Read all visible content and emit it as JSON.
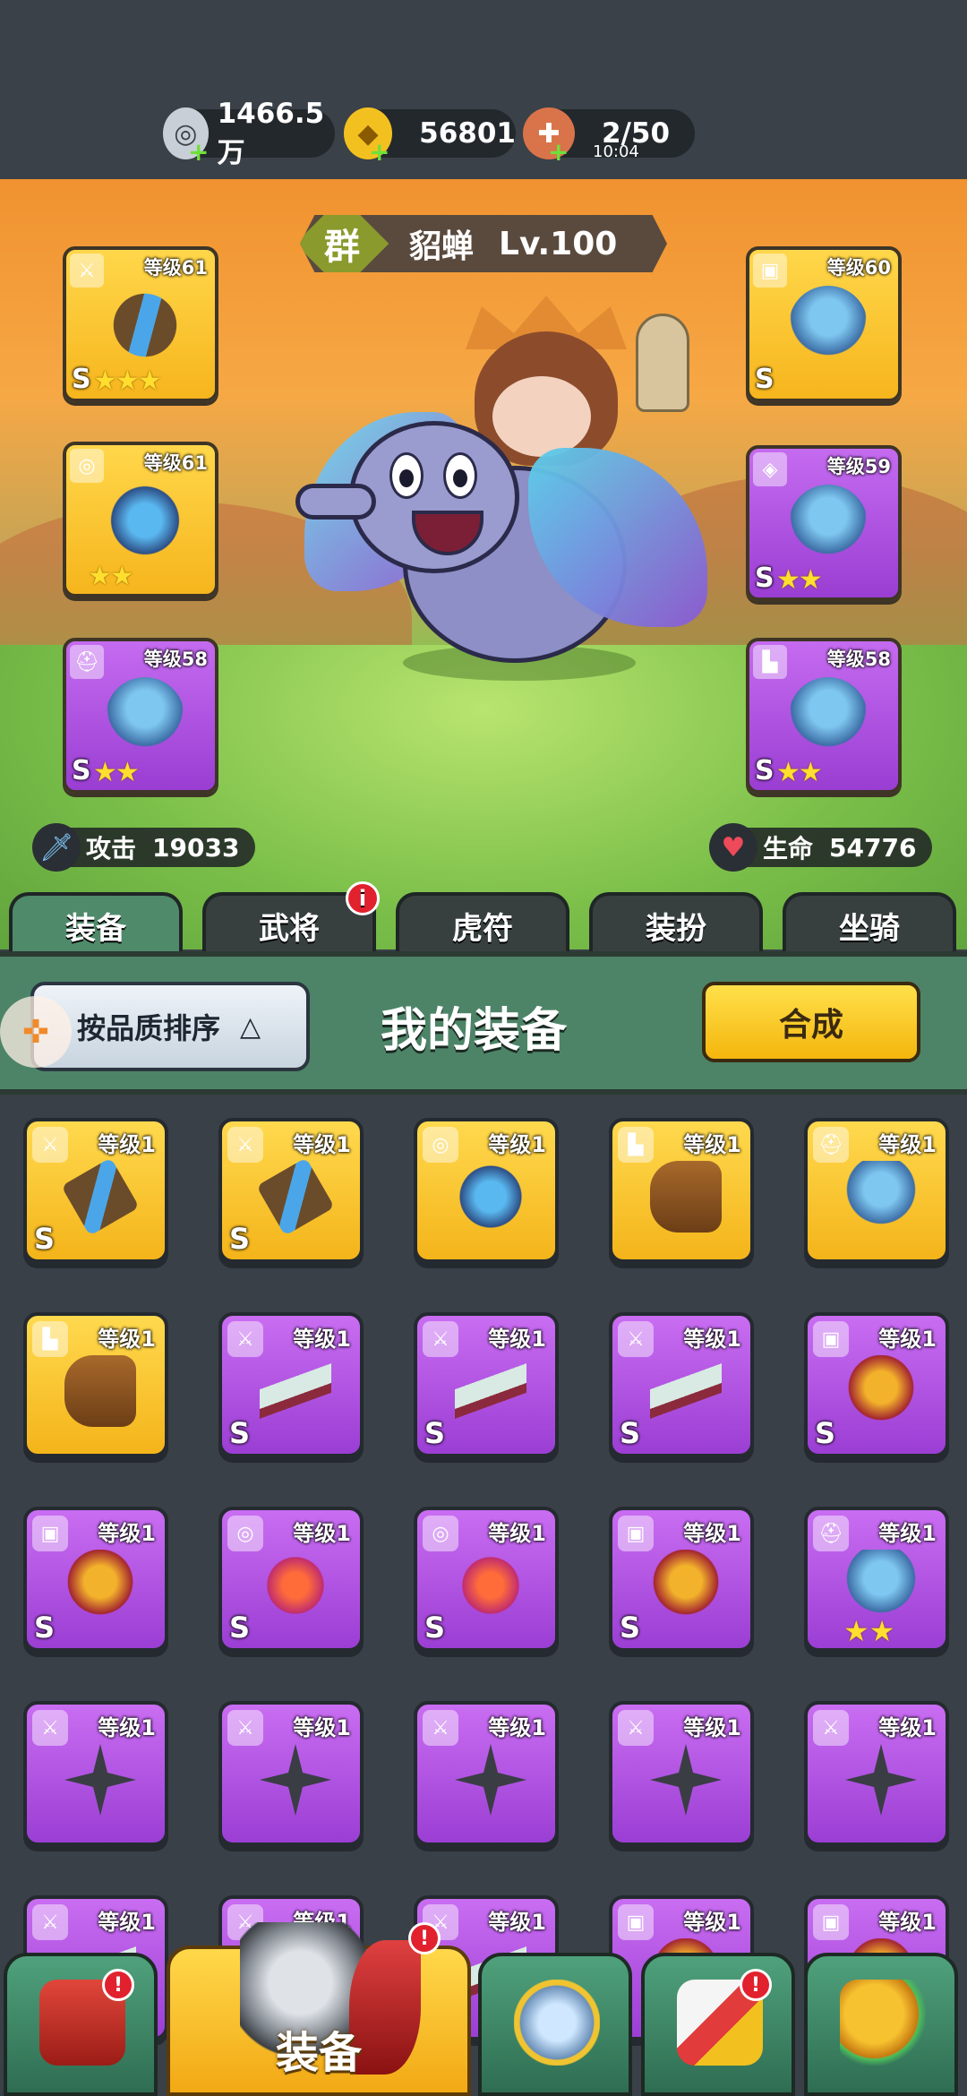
{
  "currencies": [
    {
      "icon": "silver-coin-icon",
      "value": "1466.5万"
    },
    {
      "icon": "gold-ingot-icon",
      "value": "56801"
    },
    {
      "icon": "meat-drumstick-icon",
      "value": "2/50",
      "timer": "10:04"
    }
  ],
  "hero": {
    "faction": "群",
    "name": "貂蝉",
    "level": "Lv.100",
    "attack_label": "攻击",
    "attack_value": "19033",
    "hp_label": "生命",
    "hp_value": "54776"
  },
  "equipped": [
    {
      "slot": "weapon",
      "level": "等级61",
      "rarity": "gold",
      "stars": 3,
      "grade": "S"
    },
    {
      "slot": "necklace",
      "level": "等级61",
      "rarity": "gold",
      "stars": 2,
      "grade": ""
    },
    {
      "slot": "helmet",
      "level": "等级58",
      "rarity": "purple",
      "stars": 2,
      "grade": "S"
    },
    {
      "slot": "armor",
      "level": "等级60",
      "rarity": "gold",
      "stars": 0,
      "grade": "S"
    },
    {
      "slot": "bracer",
      "level": "等级59",
      "rarity": "purple",
      "stars": 2,
      "grade": "S"
    },
    {
      "slot": "boots",
      "level": "等级58",
      "rarity": "purple",
      "stars": 2,
      "grade": "S"
    }
  ],
  "tabs": [
    {
      "label": "装备",
      "active": true
    },
    {
      "label": "武将",
      "badge": "i"
    },
    {
      "label": "虎符"
    },
    {
      "label": "装扮"
    },
    {
      "label": "坐骑"
    }
  ],
  "inventory": {
    "sort_label": "按品质排序",
    "sort_arrow": "△",
    "title": "我的装备",
    "merge_label": "合成",
    "items": [
      {
        "rarity": "gold",
        "level": "等级1",
        "grade": "S",
        "kind": "sword",
        "stars": 0
      },
      {
        "rarity": "gold",
        "level": "等级1",
        "grade": "S",
        "kind": "sword",
        "stars": 0
      },
      {
        "rarity": "gold",
        "level": "等级1",
        "grade": "",
        "kind": "neck",
        "stars": 0
      },
      {
        "rarity": "gold",
        "level": "等级1",
        "grade": "",
        "kind": "boot",
        "stars": 0
      },
      {
        "rarity": "gold",
        "level": "等级1",
        "grade": "",
        "kind": "helm",
        "stars": 0
      },
      {
        "rarity": "gold",
        "level": "等级1",
        "grade": "",
        "kind": "boot",
        "stars": 0
      },
      {
        "rarity": "purple",
        "level": "等级1",
        "grade": "S",
        "kind": "scythe",
        "stars": 0
      },
      {
        "rarity": "purple",
        "level": "等级1",
        "grade": "S",
        "kind": "scythe",
        "stars": 0
      },
      {
        "rarity": "purple",
        "level": "等级1",
        "grade": "S",
        "kind": "scythe",
        "stars": 0
      },
      {
        "rarity": "purple",
        "level": "等级1",
        "grade": "S",
        "kind": "armor",
        "stars": 0
      },
      {
        "rarity": "purple",
        "level": "等级1",
        "grade": "S",
        "kind": "armor",
        "stars": 0
      },
      {
        "rarity": "purple",
        "level": "等级1",
        "grade": "S",
        "kind": "gem",
        "stars": 0
      },
      {
        "rarity": "purple",
        "level": "等级1",
        "grade": "S",
        "kind": "gem",
        "stars": 0
      },
      {
        "rarity": "purple",
        "level": "等级1",
        "grade": "S",
        "kind": "armor",
        "stars": 0
      },
      {
        "rarity": "purple",
        "level": "等级1",
        "grade": "",
        "kind": "helm",
        "stars": 2
      },
      {
        "rarity": "purple",
        "level": "等级1",
        "grade": "",
        "kind": "shuriken",
        "stars": 0
      },
      {
        "rarity": "purple",
        "level": "等级1",
        "grade": "",
        "kind": "shuriken",
        "stars": 0
      },
      {
        "rarity": "purple",
        "level": "等级1",
        "grade": "",
        "kind": "shuriken",
        "stars": 0
      },
      {
        "rarity": "purple",
        "level": "等级1",
        "grade": "",
        "kind": "shuriken",
        "stars": 0
      },
      {
        "rarity": "purple",
        "level": "等级1",
        "grade": "",
        "kind": "shuriken",
        "stars": 0
      },
      {
        "rarity": "purple",
        "level": "等级1",
        "grade": "",
        "kind": "scythe",
        "stars": 0
      },
      {
        "rarity": "purple",
        "level": "等级1",
        "grade": "",
        "kind": "scythe",
        "stars": 0
      },
      {
        "rarity": "purple",
        "level": "等级1",
        "grade": "",
        "kind": "scythe",
        "stars": 0
      },
      {
        "rarity": "purple",
        "level": "等级1",
        "grade": "",
        "kind": "armor",
        "stars": 0
      },
      {
        "rarity": "purple",
        "level": "等级1",
        "grade": "",
        "kind": "armor",
        "stars": 0
      }
    ]
  },
  "bottom_nav": [
    {
      "name": "gate",
      "badge": "!"
    },
    {
      "name": "equipment",
      "label": "装备",
      "badge": "!",
      "active": true
    },
    {
      "name": "battle"
    },
    {
      "name": "rewards",
      "badge": "!"
    },
    {
      "name": "upgrade"
    }
  ],
  "colors": {
    "gold_rarity": "#f4b41a",
    "purple_rarity": "#9b3ed4",
    "tab_active": "#4f8a6a",
    "badge_red": "#e1212e"
  }
}
